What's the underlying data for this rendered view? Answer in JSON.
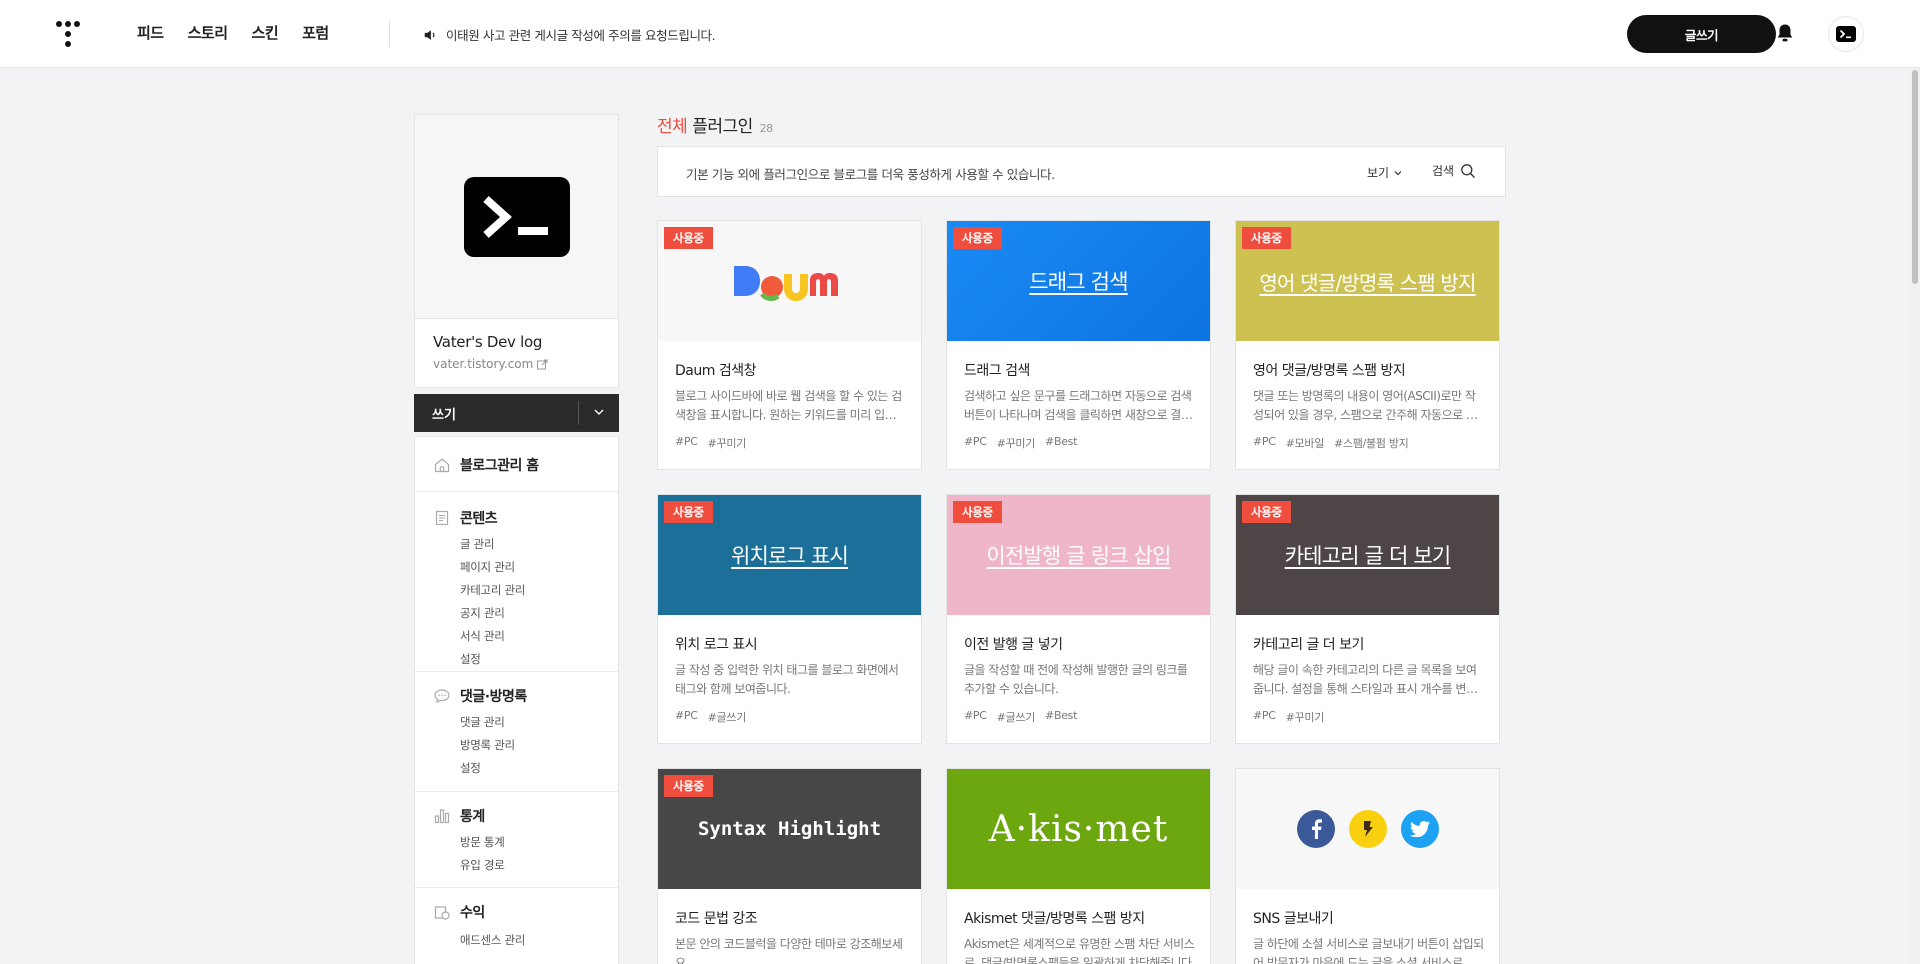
{
  "topbar": {
    "nav": [
      "피드",
      "스토리",
      "스킨",
      "포럼"
    ],
    "notice": "이태원 사고 관련 게시글 작성에 주의를 요청드립니다.",
    "write_button": "글쓰기"
  },
  "sidebar": {
    "blog_name": "Vater's Dev log",
    "blog_url": "vater.tistory.com",
    "write_label": "쓰기",
    "sections": [
      {
        "title": "블로그관리 홈",
        "icon": "home-icon",
        "items": []
      },
      {
        "title": "콘텐츠",
        "icon": "document-icon",
        "items": [
          "글 관리",
          "페이지 관리",
          "카테고리 관리",
          "공지 관리",
          "서식 관리",
          "설정"
        ]
      },
      {
        "title": "댓글·방명록",
        "icon": "comment-icon",
        "items": [
          "댓글 관리",
          "방명록 관리",
          "설정"
        ]
      },
      {
        "title": "통계",
        "icon": "stats-icon",
        "items": [
          "방문 통계",
          "유입 경로"
        ]
      },
      {
        "title": "수익",
        "icon": "revenue-icon",
        "items": [
          "애드센스 관리"
        ]
      }
    ]
  },
  "main": {
    "title_highlight": "전체",
    "title_rest": "플러그인",
    "count": "28",
    "description": "기본 기능 외에 플러그인으로 블로그를 더욱 풍성하게 사용할 수 있습니다.",
    "view_label": "보기",
    "search_label": "검색"
  },
  "badge_label": "사용중",
  "plugins": [
    {
      "name": "Daum 검색창",
      "desc": "블로그 사이드바에 바로 웹 검색을 할 수 있는 검색창을 표시합니다. 원하는 키워드를 미리 입력해둘 수도 있습니다.",
      "tags": [
        "#PC",
        "#꾸미기"
      ],
      "in_use": true,
      "thumb_text": "",
      "thumb_color": "#f7f7f7"
    },
    {
      "name": "드래그 검색",
      "desc": "검색하고 싶은 문구를 드래그하면 자동으로 검색 버튼이 나타나며 검색을 클릭하면 새창으로 결과를 보여줍니다.",
      "tags": [
        "#PC",
        "#꾸미기",
        "#Best"
      ],
      "in_use": true,
      "thumb_text": "드래그 검색",
      "thumb_color": "#1a8af5"
    },
    {
      "name": "영어 댓글/방명록 스팸 방지",
      "desc": "댓글 또는 방명록의 내용이 영어(ASCII)로만 작성되어 있을 경우, 스팸으로 간주해 자동으로 차단합니다.",
      "tags": [
        "#PC",
        "#모바일",
        "#스팸/불펌 방지"
      ],
      "in_use": true,
      "thumb_text": "영어 댓글/방명록 스팸 방지",
      "thumb_color": "#cdc251"
    },
    {
      "name": "위치 로그 표시",
      "desc": "글 작성 중 입력한 위치 태그를 블로그 화면에서 태그와 함께 보여줍니다.",
      "tags": [
        "#PC",
        "#글쓰기"
      ],
      "in_use": true,
      "thumb_text": "위치로그 표시",
      "thumb_color": "#1c6f98"
    },
    {
      "name": "이전 발행 글 넣기",
      "desc": "글을 작성할 때 전에 작성해 발행한 글의 링크를 추가할 수 있습니다.",
      "tags": [
        "#PC",
        "#글쓰기",
        "#Best"
      ],
      "in_use": true,
      "thumb_text": "이전발행 글 링크 삽입",
      "thumb_color": "#efb5c9"
    },
    {
      "name": "카테고리 글 더 보기",
      "desc": "해당 글이 속한 카테고리의 다른 글 목록을 보여줍니다. 설정을 통해 스타일과 표시 개수를 변경할 수 있습니다.",
      "tags": [
        "#PC",
        "#꾸미기"
      ],
      "in_use": true,
      "thumb_text": "카테고리 글 더 보기",
      "thumb_color": "#4e4646"
    },
    {
      "name": "코드 문법 강조",
      "desc": "본문 안의 코드블럭을 다양한 테마로 강조해보세요.",
      "tags": [],
      "in_use": true,
      "thumb_text": "Syntax Highlight",
      "thumb_color": "#474747"
    },
    {
      "name": "Akismet 댓글/방명록 스팸 방지",
      "desc": "Akismet은 세계적으로 유명한 스팸 차단 서비스로, 댓글/방명록스팸들을 일괄하게 차단해줍니다.",
      "tags": [],
      "in_use": false,
      "thumb_text": "A·kis·met",
      "thumb_color": "#6da70f"
    },
    {
      "name": "SNS 글보내기",
      "desc": "글 하단에 소셜 서비스로 글보내기 버튼이 삽입되어 방문자가 마음에 드는 글을 소셜 서비스로 보낼 수 있습니다.",
      "tags": [],
      "in_use": false,
      "thumb_text": "",
      "thumb_color": "#f7f7f7"
    }
  ]
}
